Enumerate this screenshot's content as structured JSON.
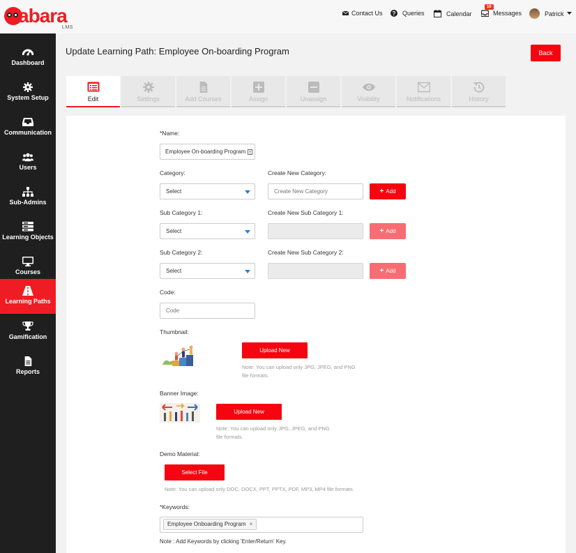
{
  "brand": {
    "name": "abara",
    "sub": "LMS"
  },
  "topnav": {
    "contact": "Contact Us",
    "queries": "Queries",
    "calendar": "Calendar",
    "messages": "Messages",
    "messages_badge": "10",
    "user": "Patrick"
  },
  "sidebar": {
    "items": [
      {
        "label": "Dashboard",
        "icon": "dashboard-icon"
      },
      {
        "label": "System Setup",
        "icon": "gear-icon"
      },
      {
        "label": "Communication",
        "icon": "inbox-icon"
      },
      {
        "label": "Users",
        "icon": "users-icon"
      },
      {
        "label": "Sub-Admins",
        "icon": "sitemap-icon"
      },
      {
        "label": "Learning Objects",
        "icon": "layers-icon"
      },
      {
        "label": "Courses",
        "icon": "monitor-icon"
      },
      {
        "label": "Learning Paths",
        "icon": "road-icon"
      },
      {
        "label": "Gamification",
        "icon": "trophy-icon"
      },
      {
        "label": "Reports",
        "icon": "report-icon"
      }
    ],
    "active": "Learning Paths"
  },
  "page": {
    "title": "Update Learning Path: Employee On-boarding Program",
    "back": "Back"
  },
  "tabs": [
    "Edit",
    "Settings",
    "Add Courses",
    "Assign",
    "Unassign",
    "Visibility",
    "Notifications",
    "History"
  ],
  "form": {
    "name_label": "*Name:",
    "name_value": "Employee On-boarding Program",
    "category_label": "Category:",
    "category_value": "Select",
    "new_category_label": "Create New Category:",
    "new_category_placeholder": "Create New Category",
    "add": "Add",
    "sub1_label": "Sub Category 1:",
    "sub1_value": "Select",
    "new_sub1_label": "Create New Sub Category 1:",
    "sub2_label": "Sub Category 2:",
    "sub2_value": "Select",
    "new_sub2_label": "Create New Sub Category 2:",
    "code_label": "Code:",
    "code_placeholder": "Code",
    "thumbnail_label": "Thumbnail:",
    "upload_new": "Upload New",
    "image_note_line1": "Note: You can upload only JPG, JPEG, and PNG",
    "image_note_line2": "file formats.",
    "banner_label": "Banner Image:",
    "demo_label": "Demo Material:",
    "select_file": "Select File",
    "demo_note": "Note: You can upload only DOC, DOCX, PPT, PPTX, PDF, MP3, MP4 file formats.",
    "keywords_label": "*Keywords:",
    "keyword_chip": "Employee Onboarding Program",
    "keyword_remove": "×",
    "keywords_note": "Note : Add Keywords by clicking 'Enter/Return' Key."
  },
  "colors": {
    "accent": "#f5050f",
    "sidebar": "#1f1f1f",
    "active": "#ef1c24"
  }
}
